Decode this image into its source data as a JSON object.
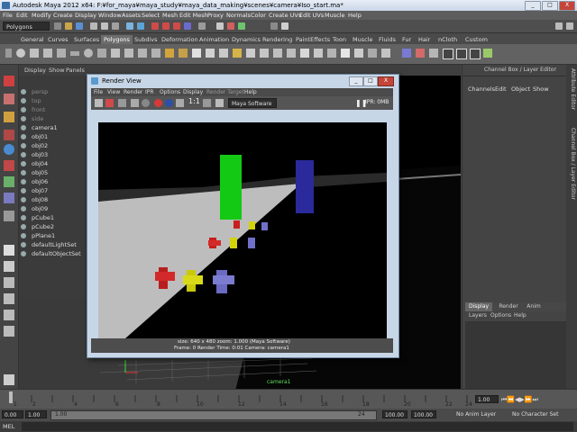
{
  "window": {
    "title": "Autodesk Maya 2012 x64: F:¥for_maya¥maya_study¥maya_data_making¥scenes¥camera¥Iso_start.ma*",
    "buttons": [
      "_",
      "□",
      "X"
    ]
  },
  "menubar": [
    "File",
    "Edit",
    "Modify",
    "Create",
    "Display",
    "Window",
    "Assets",
    "Select",
    "Mesh",
    "Edit Mesh",
    "Proxy",
    "Normals",
    "Color",
    "Create UVs",
    "Edit UVs",
    "Muscle",
    "Help"
  ],
  "mode_selector": "Polygons",
  "shelf_tabs": [
    "General",
    "Curves",
    "Surfaces",
    "Polygons",
    "Subdivs",
    "Deformation",
    "Animation",
    "Dynamics",
    "Rendering",
    "PaintEffects",
    "Toon",
    "Muscle",
    "Fluids",
    "Fur",
    "Hair",
    "nCloth",
    "Custom"
  ],
  "shelf_active": "Polygons",
  "viewport_menu": [
    "Display",
    "Show",
    "Panels"
  ],
  "outliner_items": [
    "persp",
    "top",
    "front",
    "side",
    "camera1",
    "obj01",
    "obj02",
    "obj03",
    "obj04",
    "obj05",
    "obj06",
    "obj07",
    "obj08",
    "obj09",
    "pCube1",
    "pCube2",
    "pPlane1",
    "defaultLightSet",
    "defaultObjectSet"
  ],
  "right_panel": {
    "title": "Channel Box / Layer Editor",
    "menu": [
      "Channels",
      "Edit",
      "Object",
      "Show"
    ]
  },
  "vertical_tabs": [
    "Attribute Editor",
    "Channel Box / Layer Editor"
  ],
  "layer_panel": {
    "tabs": [
      "Display",
      "Render",
      "Anim"
    ],
    "active_tab": "Display",
    "menu": [
      "Layers",
      "Options",
      "Help"
    ]
  },
  "render_view": {
    "title": "Render View",
    "buttons": [
      "_",
      "□",
      "X"
    ],
    "menu": [
      "File",
      "View",
      "Render",
      "IPR",
      "Options",
      "Display",
      "Render Target",
      "Help"
    ],
    "ratio_label": "1:1",
    "renderer": "Maya Software",
    "ipr_label": "IPR: 0MB",
    "info_line1": "size: 640 x 480  zoom: 1.000          (Maya Software)",
    "info_line2": "Frame: 0       Render Time: 0:01          Camera: camera1"
  },
  "viewport_camera_label": "camera1",
  "time_slider": {
    "ticks": [
      "1",
      "2",
      "4",
      "6",
      "8",
      "10",
      "12",
      "14",
      "16",
      "18",
      "20",
      "22",
      "24"
    ],
    "current_frame": "1.00"
  },
  "range_slider": {
    "start": "1.00",
    "start_field": "0.00",
    "range_start": "1.00",
    "range_end": "24",
    "end_field": "100.00",
    "end": "100.00",
    "anim_layer": "No Anim Layer",
    "character_set": "No Character Set"
  },
  "command_line": {
    "label": "MEL"
  },
  "colors": {
    "green": "#13c913",
    "blue": "#2a2ab8",
    "red": "#c81e1e",
    "yellow": "#d3d30a",
    "periwinkle": "#7070c8"
  }
}
